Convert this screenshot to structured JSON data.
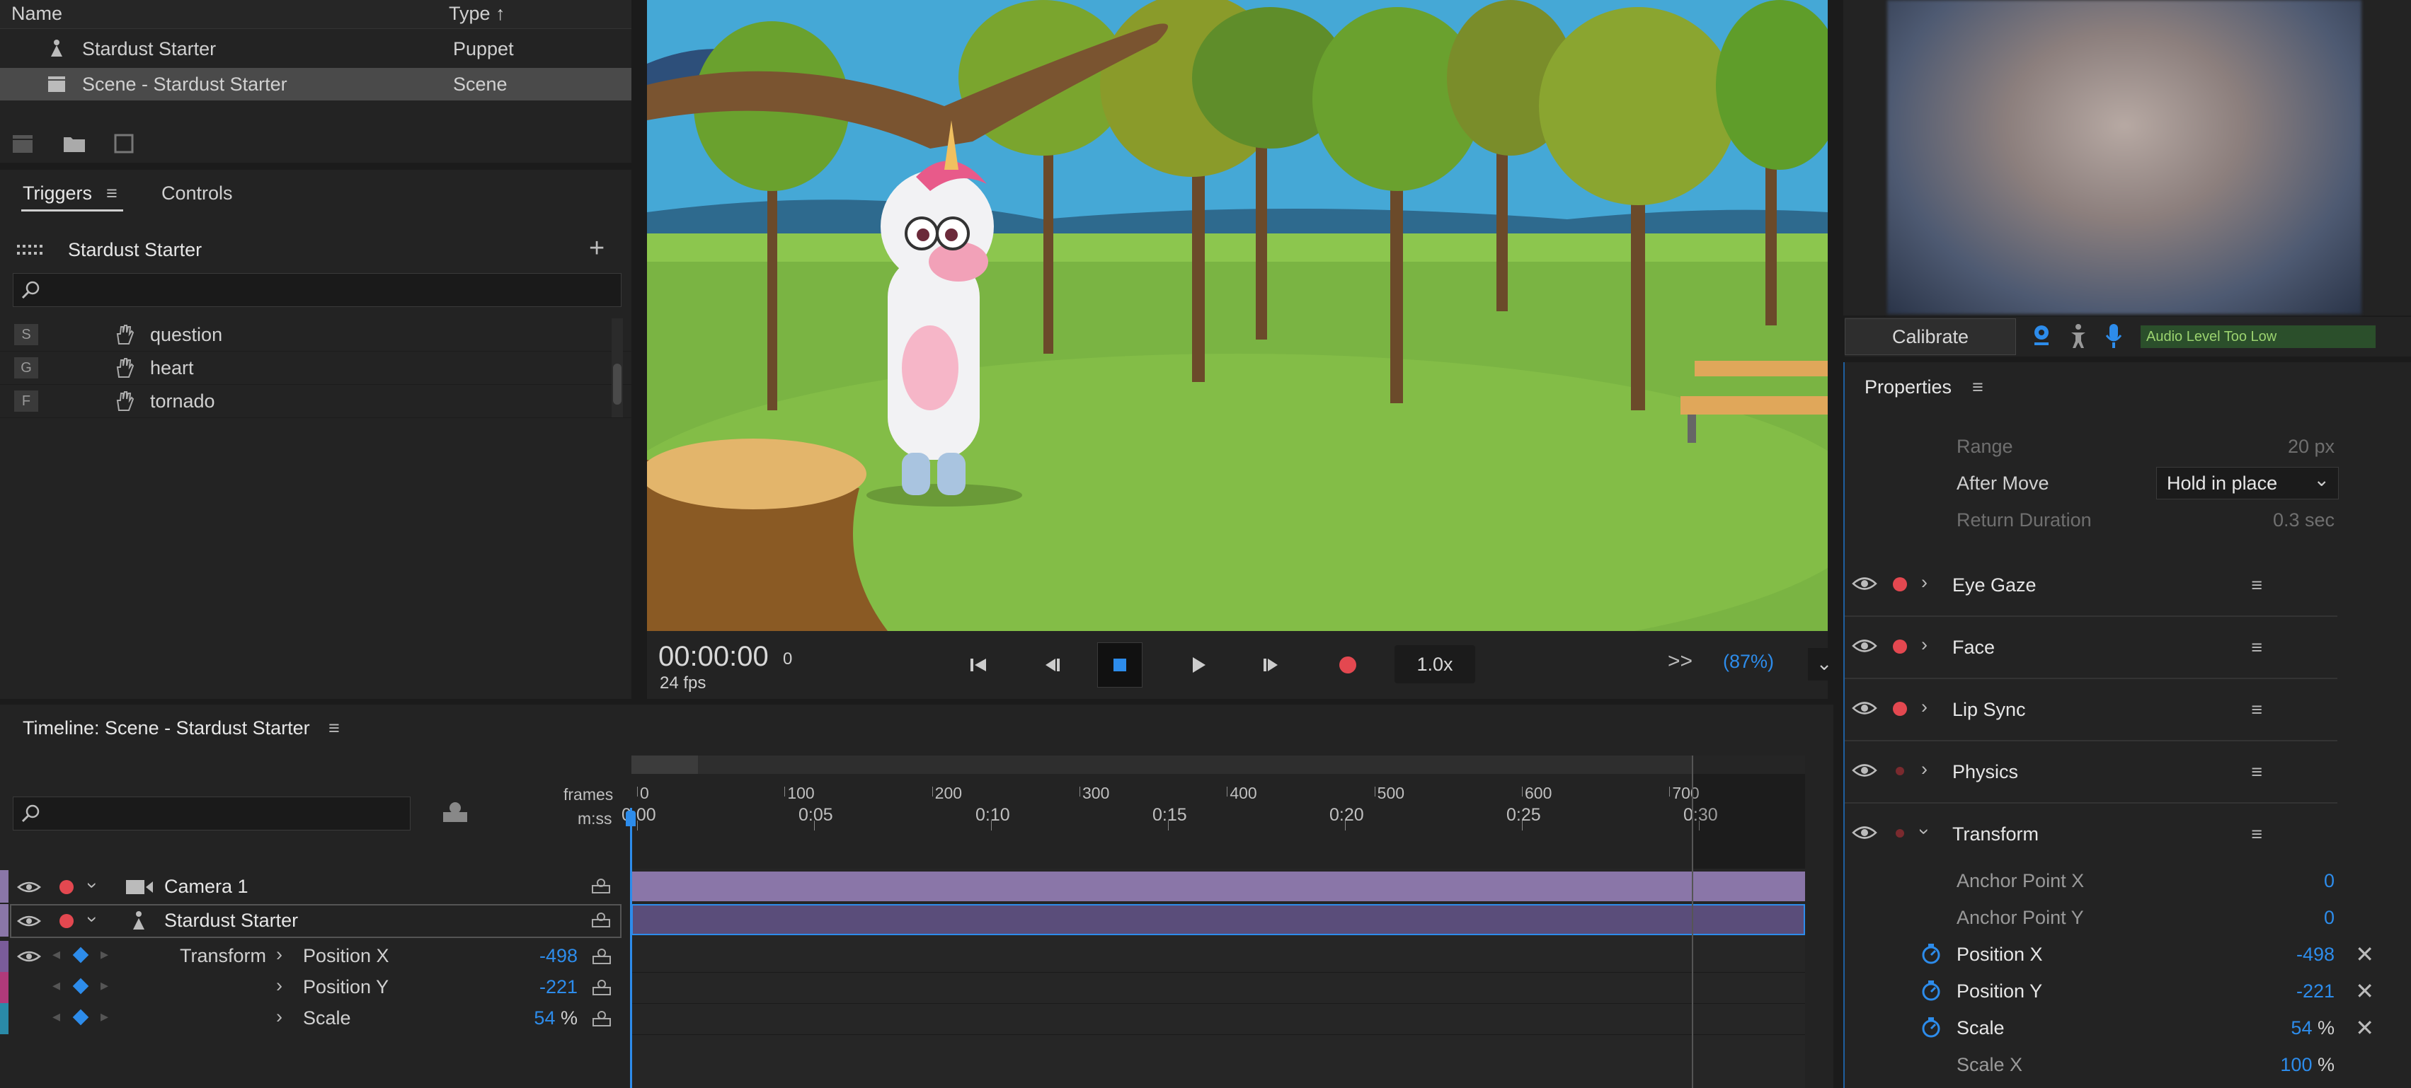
{
  "project": {
    "columns": {
      "name": "Name",
      "type": "Type"
    },
    "rows": [
      {
        "name": "Stardust Starter",
        "type": "Puppet",
        "icon": "puppet-icon",
        "selected": false
      },
      {
        "name": "Scene - Stardust Starter",
        "type": "Scene",
        "icon": "scene-icon",
        "selected": true
      }
    ]
  },
  "triggers": {
    "tab_triggers": "Triggers",
    "tab_controls": "Controls",
    "puppet_name": "Stardust Starter",
    "items": [
      {
        "key": "S",
        "name": "question"
      },
      {
        "key": "G",
        "name": "heart"
      },
      {
        "key": "F",
        "name": "tornado"
      }
    ]
  },
  "transport": {
    "timecode": "00:00:00",
    "frame": "0",
    "fps": "24 fps",
    "speed": "1.0x",
    "zoom": "(87%)",
    "more": ">>"
  },
  "camera": {
    "calibrate": "Calibrate",
    "audio_status": "Audio Level Too Low"
  },
  "properties": {
    "title": "Properties",
    "top_params": [
      {
        "label": "Range",
        "value": "20 px"
      },
      {
        "label": "After Move",
        "value": "Hold in place"
      },
      {
        "label": "Return Duration",
        "value": "0.3 sec"
      }
    ],
    "sections": [
      "Eye Gaze",
      "Face",
      "Lip Sync",
      "Physics",
      "Transform"
    ],
    "transform_params": [
      {
        "label": "Anchor Point X",
        "value": "0",
        "unit": ""
      },
      {
        "label": "Anchor Point Y",
        "value": "0",
        "unit": ""
      },
      {
        "label": "Position X",
        "value": "-498",
        "unit": ""
      },
      {
        "label": "Position Y",
        "value": "-221",
        "unit": ""
      },
      {
        "label": "Scale",
        "value": "54",
        "unit": "%"
      },
      {
        "label": "Scale X",
        "value": "100",
        "unit": "%"
      }
    ]
  },
  "timeline": {
    "title": "Timeline: Scene - Stardust Starter",
    "frames_label": "frames",
    "time_label": "m:ss",
    "frame_ticks": [
      "0",
      "100",
      "200",
      "300",
      "400",
      "500",
      "600",
      "700"
    ],
    "time_ticks": [
      "0:00",
      "0:05",
      "0:10",
      "0:15",
      "0:20",
      "0:25",
      "0:30"
    ],
    "tracks": [
      {
        "name": "Camera 1",
        "type": "camera"
      },
      {
        "name": "Stardust Starter",
        "type": "puppet"
      }
    ],
    "group_label": "Transform",
    "props": [
      {
        "name": "Position X",
        "value": "-498",
        "unit": ""
      },
      {
        "name": "Position Y",
        "value": "-221",
        "unit": ""
      },
      {
        "name": "Scale",
        "value": "54",
        "unit": "%"
      }
    ]
  },
  "colors": {
    "accent": "#2d8ceb",
    "record": "#e34850",
    "camera_track": "#8a76a8",
    "puppet_track": "#5a4d7a"
  }
}
